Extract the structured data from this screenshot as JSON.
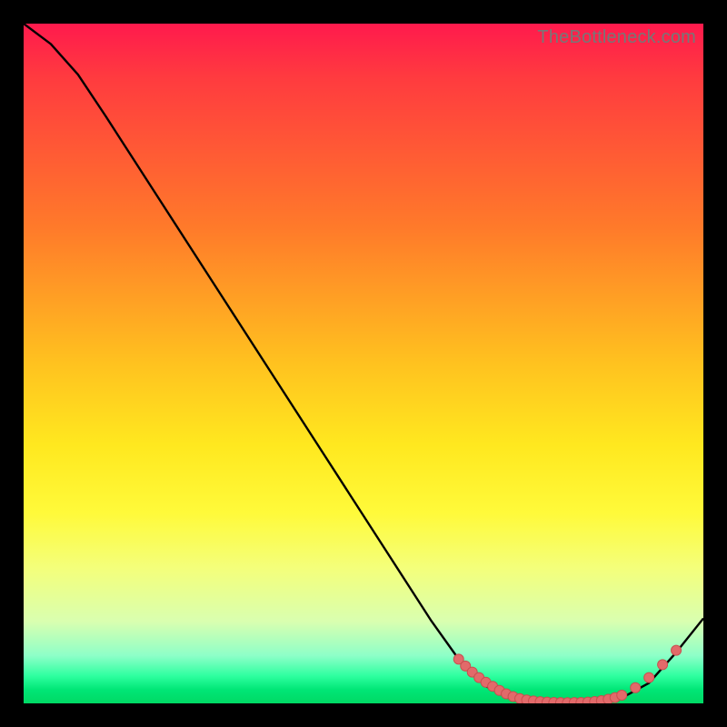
{
  "watermark": "TheBottleneck.com",
  "colors": {
    "curve": "#000000",
    "marker_fill": "#e26a6a",
    "marker_stroke": "#c94f4f",
    "background_black": "#000000"
  },
  "chart_data": {
    "type": "line",
    "title": "",
    "xlabel": "",
    "ylabel": "",
    "xlim": [
      0,
      100
    ],
    "ylim": [
      0,
      100
    ],
    "grid": false,
    "series": [
      {
        "name": "curve",
        "x": [
          0,
          4,
          8,
          12,
          16,
          20,
          24,
          28,
          32,
          36,
          40,
          44,
          48,
          52,
          56,
          60,
          64,
          68,
          72,
          76,
          80,
          84,
          88,
          92,
          96,
          100
        ],
        "y": [
          100,
          97,
          92.5,
          86.5,
          80.3,
          74.1,
          67.9,
          61.7,
          55.5,
          49.3,
          43.1,
          36.9,
          30.7,
          24.5,
          18.3,
          12.1,
          6.5,
          2.5,
          0.8,
          0.2,
          0.1,
          0.2,
          0.8,
          3.0,
          7.5,
          12.5
        ]
      }
    ],
    "markers": [
      {
        "x": 64,
        "y": 6.5
      },
      {
        "x": 65,
        "y": 5.5
      },
      {
        "x": 66,
        "y": 4.6
      },
      {
        "x": 67,
        "y": 3.8
      },
      {
        "x": 68,
        "y": 3.1
      },
      {
        "x": 69,
        "y": 2.5
      },
      {
        "x": 70,
        "y": 1.9
      },
      {
        "x": 71,
        "y": 1.4
      },
      {
        "x": 72,
        "y": 1.0
      },
      {
        "x": 73,
        "y": 0.7
      },
      {
        "x": 74,
        "y": 0.5
      },
      {
        "x": 75,
        "y": 0.35
      },
      {
        "x": 76,
        "y": 0.25
      },
      {
        "x": 77,
        "y": 0.18
      },
      {
        "x": 78,
        "y": 0.14
      },
      {
        "x": 79,
        "y": 0.11
      },
      {
        "x": 80,
        "y": 0.1
      },
      {
        "x": 81,
        "y": 0.11
      },
      {
        "x": 82,
        "y": 0.14
      },
      {
        "x": 83,
        "y": 0.19
      },
      {
        "x": 84,
        "y": 0.27
      },
      {
        "x": 85,
        "y": 0.4
      },
      {
        "x": 86,
        "y": 0.6
      },
      {
        "x": 87,
        "y": 0.85
      },
      {
        "x": 88,
        "y": 1.2
      },
      {
        "x": 90,
        "y": 2.3
      },
      {
        "x": 92,
        "y": 3.8
      },
      {
        "x": 94,
        "y": 5.7
      },
      {
        "x": 96,
        "y": 7.8
      }
    ]
  }
}
